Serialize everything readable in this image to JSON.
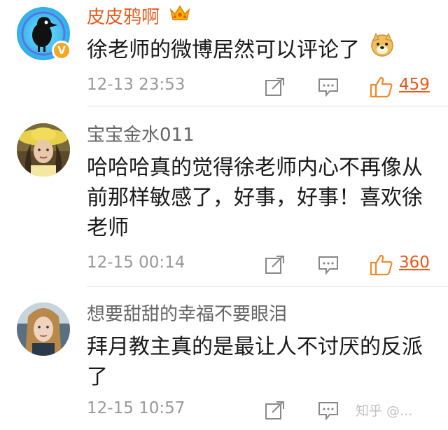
{
  "comments": [
    {
      "username": "皮皮鸦啊",
      "text": "徐老师的微博居然可以评论了",
      "time": "12-13 23:53",
      "likes": "459",
      "verified_badge": "V",
      "emoji": "doge-emoji",
      "username_color": "#e8591a"
    },
    {
      "username": "宝宝金水011",
      "text": "哈哈哈真的觉得徐老师内心不再像从前那样敏感了，好事，好事！喜欢徐老师",
      "time": "12-15 00:14",
      "likes": "360",
      "username_color": "#666666"
    },
    {
      "username": "想要甜甜的幸福不要眼泪",
      "text": "拜月教主真的是最让人不讨厌的反派了",
      "time": "12-15 10:57",
      "likes": "",
      "username_color": "#666666"
    }
  ],
  "watermark": "知乎 @...",
  "colors": {
    "accent": "#e8591a",
    "meta": "#999999",
    "text": "#1a1a1a",
    "divider": "#e6e6e6"
  },
  "icons": {
    "share": "share-icon",
    "comment": "comment-icon",
    "like": "thumbs-up-icon",
    "crown": "crown-icon"
  }
}
